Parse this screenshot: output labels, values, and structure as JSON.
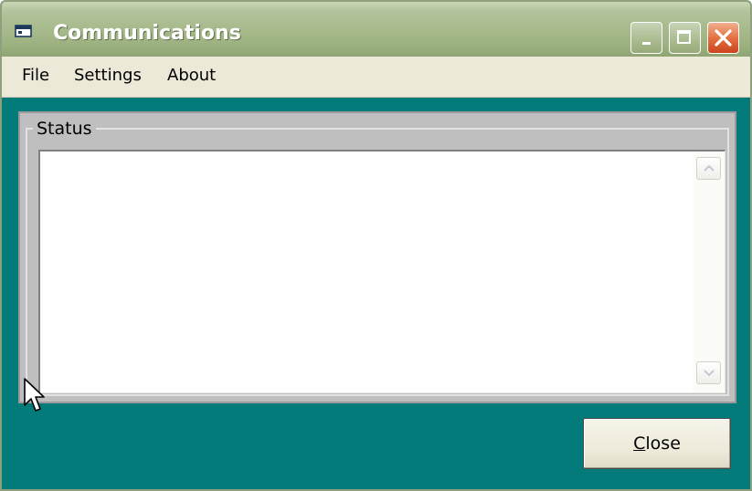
{
  "window": {
    "title": "Communications",
    "controls": {
      "minimize": "minimize-icon",
      "maximize": "maximize-icon",
      "close": "close-icon"
    }
  },
  "menu": {
    "items": [
      {
        "label": "File"
      },
      {
        "label": "Settings"
      },
      {
        "label": "About"
      }
    ]
  },
  "status_group": {
    "label": "Status",
    "text": ""
  },
  "buttons": {
    "close_label_accel": "C",
    "close_label_rest": "lose"
  },
  "colors": {
    "window_background": "#047b7b",
    "titlebar": "#a7ba8c",
    "close_button": "#e26c3c",
    "menubar": "#ece9d8",
    "groupbox": "#c0bfc0"
  },
  "icons": {
    "app": "window-app-icon",
    "cursor": "mouse-pointer-icon",
    "scroll_up": "scroll-up-arrow-icon",
    "scroll_down": "scroll-down-arrow-icon"
  }
}
